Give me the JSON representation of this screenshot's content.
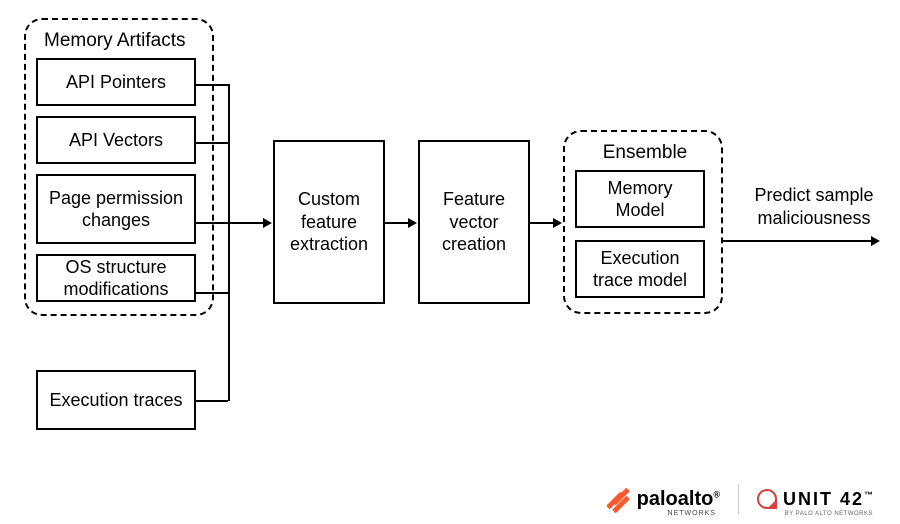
{
  "inputs": {
    "group_title": "Memory Artifacts",
    "items": [
      "API Pointers",
      "API Vectors",
      "Page permission changes",
      "OS structure modifications"
    ],
    "extra": "Execution traces"
  },
  "process": {
    "extraction": "Custom feature extraction",
    "vector": "Feature vector creation"
  },
  "ensemble": {
    "group_title": "Ensemble",
    "items": [
      "Memory Model",
      "Execution trace model"
    ]
  },
  "output_label": "Predict sample maliciousness",
  "footer": {
    "brand1": "paloalto",
    "brand1_sub": "NETWORKS",
    "brand2": "UNIT 42",
    "brand2_sub": "BY PALO ALTO NETWORKS",
    "reg": "®",
    "tm": "™"
  }
}
